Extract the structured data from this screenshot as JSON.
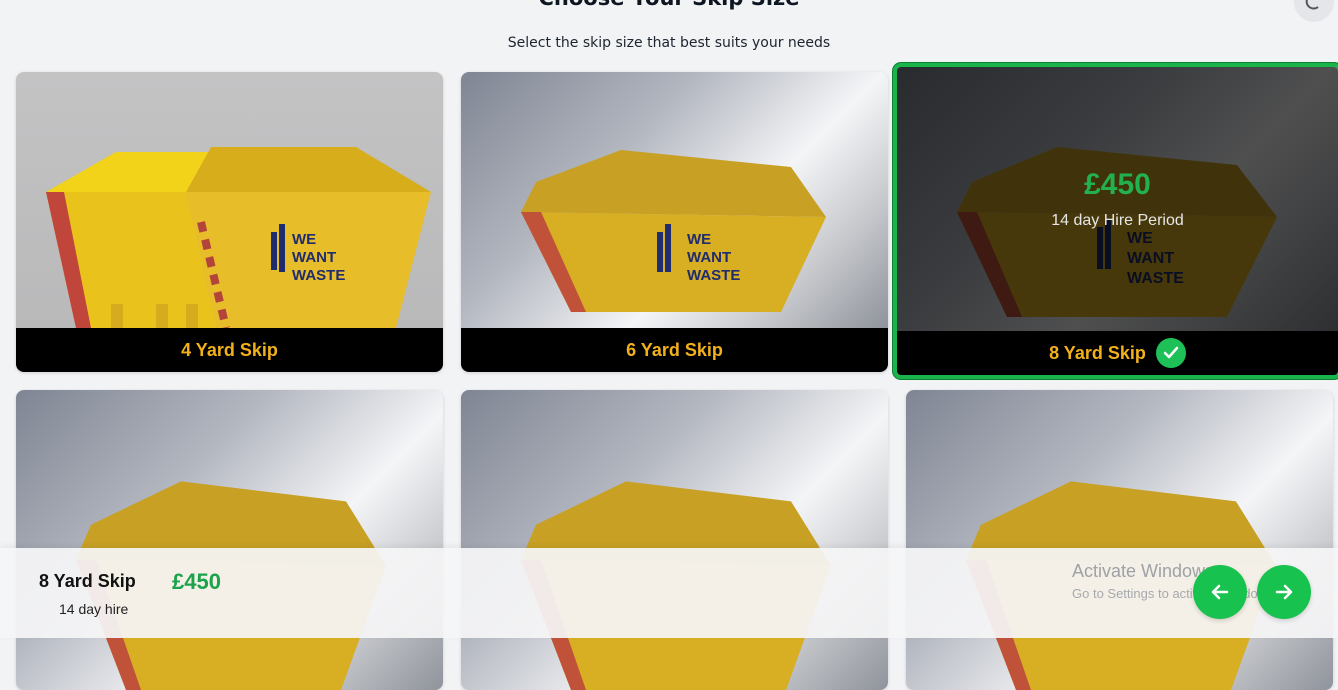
{
  "header": {
    "title": "Choose Your Skip Size",
    "subtitle": "Select the skip size that best suits your needs"
  },
  "theme_toggle": {
    "icon": "moon-icon"
  },
  "brand": {
    "logo_lines": [
      "WE",
      "WANT",
      "WASTE"
    ]
  },
  "cards": [
    {
      "label": "4 Yard Skip",
      "selected": false
    },
    {
      "label": "6 Yard Skip",
      "selected": false
    },
    {
      "label": "8 Yard Skip",
      "selected": true,
      "price": "£450",
      "period": "14 day Hire Period"
    },
    {
      "label": "",
      "selected": false
    },
    {
      "label": "",
      "selected": false
    },
    {
      "label": "",
      "selected": false
    }
  ],
  "selection_bar": {
    "name": "8 Yard Skip",
    "price": "£450",
    "period": "14 day hire"
  },
  "watermark": {
    "title": "Activate Windows",
    "subtitle": "Go to Settings to activate Windows."
  },
  "colors": {
    "accent_green": "#19b44a",
    "label_yellow": "#f2b11b",
    "skip_yellow": "#e3b526"
  }
}
